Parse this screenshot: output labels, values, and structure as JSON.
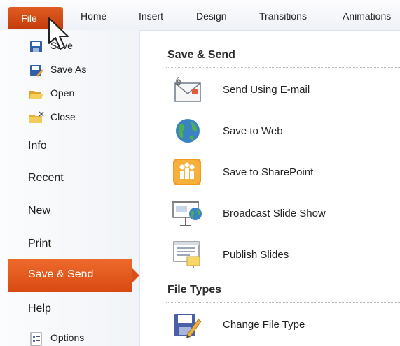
{
  "ribbon": {
    "tabs": [
      "File",
      "Home",
      "Insert",
      "Design",
      "Transitions",
      "Animations"
    ]
  },
  "sidebar": {
    "small_items": [
      {
        "label": "Save",
        "icon": "save-icon"
      },
      {
        "label": "Save As",
        "icon": "save-as-icon"
      },
      {
        "label": "Open",
        "icon": "open-folder-icon"
      },
      {
        "label": "Close",
        "icon": "close-folder-icon"
      }
    ],
    "big_items": [
      "Info",
      "Recent",
      "New",
      "Print"
    ],
    "selected_item": "Save & Send",
    "help": "Help",
    "options": "Options"
  },
  "main": {
    "save_send": {
      "title": "Save & Send",
      "options": [
        {
          "label": "Send Using E-mail",
          "icon": "email-icon"
        },
        {
          "label": "Save to Web",
          "icon": "globe-icon"
        },
        {
          "label": "Save to SharePoint",
          "icon": "sharepoint-icon"
        },
        {
          "label": "Broadcast Slide Show",
          "icon": "broadcast-icon"
        },
        {
          "label": "Publish Slides",
          "icon": "publish-slides-icon"
        }
      ]
    },
    "file_types": {
      "title": "File Types",
      "options": [
        {
          "label": "Change File Type",
          "icon": "change-file-type-icon"
        }
      ]
    }
  },
  "colors": {
    "accent": "#e0561c",
    "sidebar_bg": "#f4f6f9"
  }
}
